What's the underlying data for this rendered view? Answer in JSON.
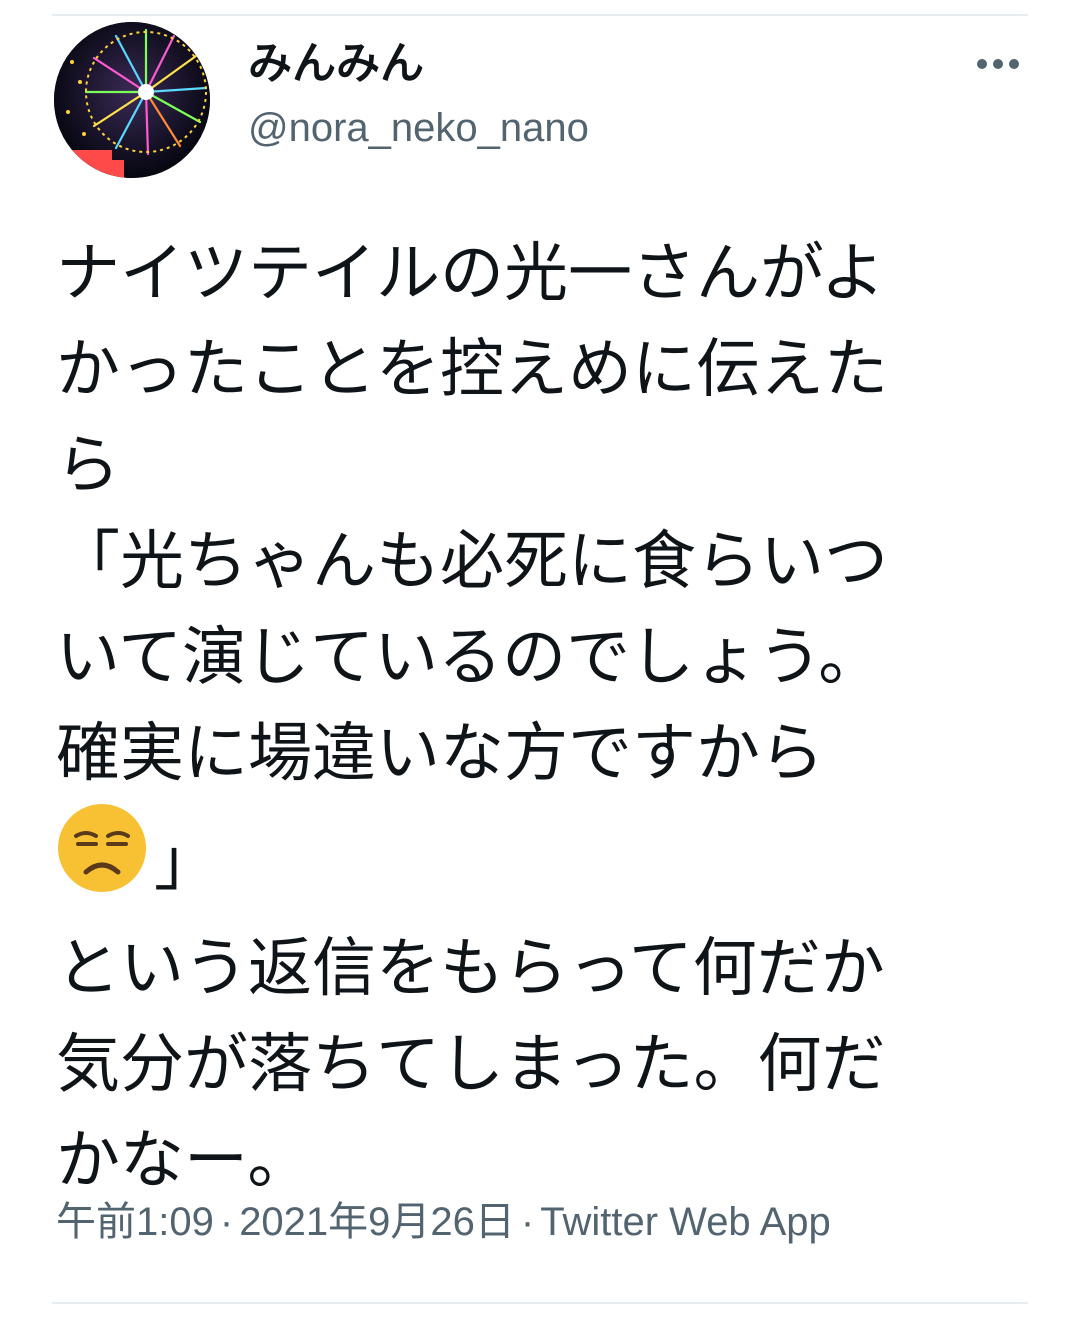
{
  "tweet": {
    "author": {
      "display_name": "みんみん",
      "handle": "@nora_neko_nano",
      "avatar_icon": "ferris-wheel-night-avatar"
    },
    "more_icon": "more-horizontal-icon",
    "text_lines": [
      "ナイツテイルの光一さんがよ",
      "かったことを控えめに伝えた",
      "ら",
      "「光ちゃんも必死に食らいつ",
      "いて演じているのでしょう。",
      "確実に場違いな方ですから",
      "」",
      "という返信をもらって何だか",
      "気分が落ちてしまった。何だ",
      "かなー。"
    ],
    "emoji": "unamused-face-emoji",
    "time": "午前1:09",
    "separator": "·",
    "date": "2021年9月26日",
    "source": "Twitter Web App"
  },
  "colors": {
    "text": "#0f1419",
    "secondary": "#536471",
    "divider": "#e6ecf0",
    "emoji_face": "#f7c133"
  }
}
